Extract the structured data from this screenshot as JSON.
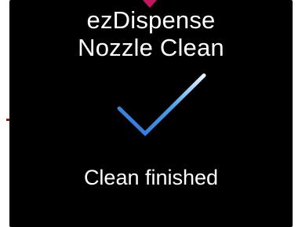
{
  "screen": {
    "title_line1": "ezDispense",
    "title_line2": "Nozzle Clean",
    "status": "Clean finished",
    "icon": "checkmark-icon"
  },
  "colors": {
    "background": "#000000",
    "text": "#ffffff",
    "check_gradient_start": "#2f6fd8",
    "check_gradient_end": "#e8f6ff",
    "indicator": "#c2185b"
  }
}
